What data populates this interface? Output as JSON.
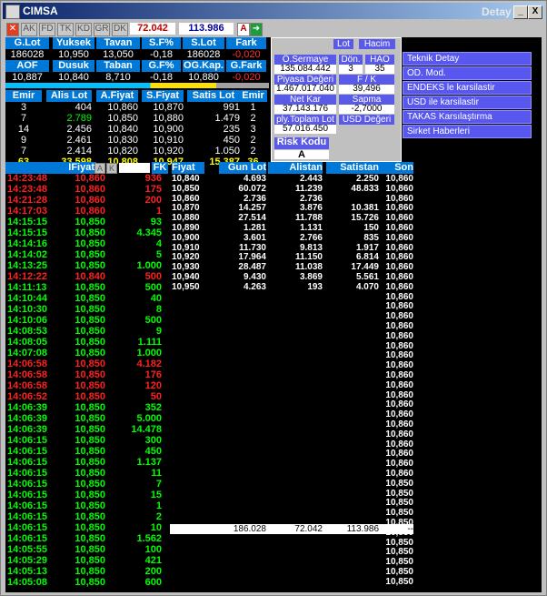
{
  "window": {
    "title": "CIMSA",
    "detail": "Detay",
    "minimize": "_",
    "maximize": "□",
    "close": "X"
  },
  "toolbar": {
    "tabs": [
      "AK",
      "FD",
      "TK",
      "KD",
      "GR",
      "DK"
    ],
    "value1": "72.042",
    "value2": "113.986",
    "a_label": "A"
  },
  "summary": {
    "headers1": [
      "G.Lot",
      "Yuksek",
      "Tavan",
      "S.F%",
      "S.Lot",
      "Fark"
    ],
    "values1": [
      "186028",
      "10,950",
      "13,050",
      "-0,18",
      "186028",
      "-0,020"
    ],
    "headers2": [
      "AOF",
      "Dusuk",
      "Taban",
      "G.F%",
      "OG.Kap.",
      "G.Fark"
    ],
    "values2": [
      "10,887",
      "10,840",
      "8,710",
      "-0,18",
      "10,880",
      "-0,020"
    ]
  },
  "depth": {
    "headers": [
      "Emir",
      "Alis Lot",
      "A.Fiyat",
      "S.Fiyat",
      "Satis Lot",
      "Emir"
    ],
    "rows": [
      [
        "3",
        "404",
        "10,860",
        "10,870",
        "991",
        "1"
      ],
      [
        "7",
        "2.789",
        "10,850",
        "10,880",
        "1.479",
        "2"
      ],
      [
        "14",
        "2.456",
        "10,840",
        "10,900",
        "235",
        "3"
      ],
      [
        "9",
        "2.461",
        "10,830",
        "10,910",
        "450",
        "2"
      ],
      [
        "7",
        "2.414",
        "10,820",
        "10,920",
        "1.050",
        "2"
      ]
    ],
    "totals": [
      "63",
      "33.598",
      "10,808",
      "10,947",
      "15.387",
      "36"
    ]
  },
  "panel": {
    "toggle1": "Lot",
    "toggle2": "Hacim",
    "items": [
      {
        "label": "Ö.Sermaye",
        "value": "135.084.442"
      },
      {
        "label": "Dön.",
        "value": "3"
      },
      {
        "label": "HAO",
        "value": "35"
      },
      {
        "label": "Piyasa Değeri",
        "value": "1.467.017.040"
      },
      {
        "label": "F / K",
        "value": "39,496"
      },
      {
        "label": "Net Kar",
        "value": "37.143.176"
      },
      {
        "label": "Sapma",
        "value": "-2,7000"
      },
      {
        "label": "ply.Toplam Lot",
        "value": "57.016.450"
      },
      {
        "label": "USD Değeri",
        "value": ""
      },
      {
        "label": "Risk Kodu",
        "value": "A"
      }
    ]
  },
  "menu": [
    "Teknik Detay",
    "OD. Mod.",
    "ENDEKS le karsilastir",
    "USD ile karsilastir",
    "TAKAS Karsılaştırma",
    "Sirket Haberleri"
  ],
  "trades": {
    "header": "IFiyat",
    "a": "A",
    "k": "K",
    "fk": "FK",
    "rows": [
      [
        "14:23:48",
        "10,860",
        "936",
        "r"
      ],
      [
        "14:23:48",
        "10,860",
        "175",
        "r"
      ],
      [
        "14:21:28",
        "10,860",
        "200",
        "r"
      ],
      [
        "14:17:03",
        "10,860",
        "1",
        "r"
      ],
      [
        "14:15:15",
        "10,850",
        "93",
        "g"
      ],
      [
        "14:15:15",
        "10,850",
        "4.345",
        "g"
      ],
      [
        "14:14:16",
        "10,850",
        "4",
        "g"
      ],
      [
        "14:14:02",
        "10,850",
        "5",
        "g"
      ],
      [
        "14:13:25",
        "10,850",
        "1.000",
        "g"
      ],
      [
        "14:12:22",
        "10,840",
        "500",
        "r"
      ],
      [
        "14:11:13",
        "10,850",
        "500",
        "g"
      ],
      [
        "14:10:44",
        "10,850",
        "40",
        "g"
      ],
      [
        "14:10:30",
        "10,850",
        "8",
        "g"
      ],
      [
        "14:10:06",
        "10,850",
        "500",
        "g"
      ],
      [
        "14:08:53",
        "10,850",
        "9",
        "g"
      ],
      [
        "14:08:05",
        "10,850",
        "1.111",
        "g"
      ],
      [
        "14:07:08",
        "10,850",
        "1.000",
        "g"
      ],
      [
        "14:06:58",
        "10,850",
        "4.182",
        "r"
      ],
      [
        "14:06:58",
        "10,850",
        "176",
        "r"
      ],
      [
        "14:06:58",
        "10,850",
        "120",
        "r"
      ],
      [
        "14:06:52",
        "10,850",
        "50",
        "r"
      ],
      [
        "14:06:39",
        "10,850",
        "352",
        "g"
      ],
      [
        "14:06:39",
        "10,850",
        "5.000",
        "g"
      ],
      [
        "14:06:39",
        "10,850",
        "14.478",
        "g"
      ],
      [
        "14:06:15",
        "10,850",
        "300",
        "g"
      ],
      [
        "14:06:15",
        "10,850",
        "450",
        "g"
      ],
      [
        "14:06:15",
        "10,850",
        "1.137",
        "g"
      ],
      [
        "14:06:15",
        "10,850",
        "11",
        "g"
      ],
      [
        "14:06:15",
        "10,850",
        "7",
        "g"
      ],
      [
        "14:06:15",
        "10,850",
        "15",
        "g"
      ],
      [
        "14:06:15",
        "10,850",
        "1",
        "g"
      ],
      [
        "14:06:15",
        "10,850",
        "2",
        "g"
      ],
      [
        "14:06:15",
        "10,850",
        "10",
        "g"
      ],
      [
        "14:06:15",
        "10,850",
        "1.562",
        "g"
      ],
      [
        "14:05:55",
        "10,850",
        "100",
        "g"
      ],
      [
        "14:05:29",
        "10,850",
        "421",
        "g"
      ],
      [
        "14:05:13",
        "10,850",
        "200",
        "g"
      ],
      [
        "14:05:08",
        "10,850",
        "600",
        "g"
      ]
    ]
  },
  "pricebreak": {
    "headers": [
      "Fiyat",
      "Gun Lot",
      "Alistan",
      "Satistan",
      "Son"
    ],
    "rows": [
      [
        "10,840",
        "4.693",
        "2.443",
        "2.250",
        "10,860"
      ],
      [
        "10,850",
        "60.072",
        "11.239",
        "48.833",
        "10,860"
      ],
      [
        "10,860",
        "2.736",
        "2.736",
        "",
        "10,860"
      ],
      [
        "10,870",
        "14.257",
        "3.876",
        "10.381",
        "10,860"
      ],
      [
        "10,880",
        "27.514",
        "11.788",
        "15.726",
        "10,860"
      ],
      [
        "10,890",
        "1.281",
        "1.131",
        "150",
        "10,860"
      ],
      [
        "10,900",
        "3.601",
        "2.766",
        "835",
        "10,860"
      ],
      [
        "10,910",
        "11.730",
        "9.813",
        "1.917",
        "10,860"
      ],
      [
        "10,920",
        "17.964",
        "11.150",
        "6.814",
        "10,860"
      ],
      [
        "10,930",
        "28.487",
        "11.038",
        "17.449",
        "10,860"
      ],
      [
        "10,940",
        "9.430",
        "3.869",
        "5.561",
        "10,860"
      ],
      [
        "10,950",
        "4.263",
        "193",
        "4.070",
        "10,860"
      ]
    ],
    "son_extra": [
      "10,860",
      "10,860",
      "10,860",
      "10,860",
      "10,860",
      "10,860",
      "10,860",
      "10,860",
      "10,860",
      "10,860",
      "10,860",
      "10,860",
      "10,860",
      "10,860",
      "10,860",
      "10,860",
      "10,860",
      "10,860",
      "10,860",
      "10,850",
      "10,850",
      "10,850",
      "10,850",
      "10,850",
      "10,850",
      "10,850",
      "10,850",
      "10,850",
      "10,850",
      "10,850"
    ],
    "totals": [
      "186.028",
      "72.042",
      "113.986",
      "--"
    ]
  }
}
